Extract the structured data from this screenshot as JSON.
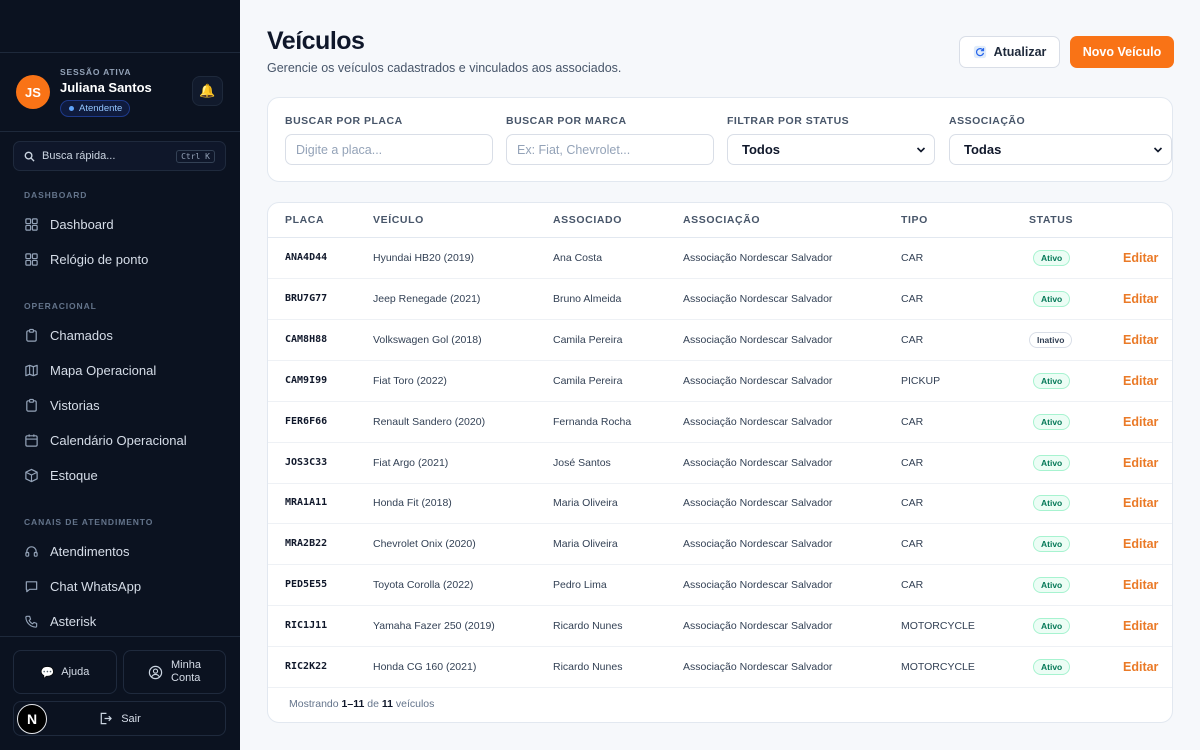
{
  "sidebar": {
    "user": {
      "initials": "JS",
      "session_label": "SESSÃO ATIVA",
      "name": "Juliana Santos",
      "role": "Atendente"
    },
    "search": {
      "label": "Busca rápida...",
      "shortcut": "Ctrl K"
    },
    "sections": [
      {
        "title": "DASHBOARD",
        "items": [
          {
            "label": "Dashboard",
            "icon": "grid-icon"
          },
          {
            "label": "Relógio de ponto",
            "icon": "grid-icon"
          }
        ]
      },
      {
        "title": "OPERACIONAL",
        "items": [
          {
            "label": "Chamados",
            "icon": "clipboard-icon"
          },
          {
            "label": "Mapa Operacional",
            "icon": "map-icon"
          },
          {
            "label": "Vistorias",
            "icon": "clipboard-icon"
          },
          {
            "label": "Calendário Operacional",
            "icon": "calendar-icon"
          },
          {
            "label": "Estoque",
            "icon": "box-icon"
          }
        ]
      },
      {
        "title": "CANAIS DE ATENDIMENTO",
        "items": [
          {
            "label": "Atendimentos",
            "icon": "headset-icon"
          },
          {
            "label": "Chat WhatsApp",
            "icon": "chat-icon"
          },
          {
            "label": "Asterisk",
            "icon": "phone-icon"
          }
        ]
      }
    ],
    "footer": {
      "help": "Ajuda",
      "account_line1": "Minha",
      "account_line2": "Conta",
      "logout": "Sair",
      "logo_letter": "N"
    }
  },
  "header": {
    "title": "Veículos",
    "subtitle": "Gerencie os veículos cadastrados e vinculados aos associados.",
    "refresh_label": "Atualizar",
    "new_label": "Novo Veículo"
  },
  "filters": {
    "plate": {
      "label": "BUSCAR POR PLACA",
      "placeholder": "Digite a placa..."
    },
    "brand": {
      "label": "BUSCAR POR MARCA",
      "placeholder": "Ex: Fiat, Chevrolet..."
    },
    "status": {
      "label": "FILTRAR POR STATUS",
      "value": "Todos"
    },
    "association": {
      "label": "ASSOCIAÇÃO",
      "value": "Todas"
    }
  },
  "table": {
    "columns": [
      "PLACA",
      "VEÍCULO",
      "ASSOCIADO",
      "ASSOCIAÇÃO",
      "TIPO",
      "STATUS"
    ],
    "edit_label": "Editar",
    "rows": [
      {
        "plate": "ANA4D44",
        "vehicle": "Hyundai HB20 (2019)",
        "member": "Ana Costa",
        "association": "Associação Nordescar Salvador",
        "type": "CAR",
        "status": "Ativo"
      },
      {
        "plate": "BRU7G77",
        "vehicle": "Jeep Renegade (2021)",
        "member": "Bruno Almeida",
        "association": "Associação Nordescar Salvador",
        "type": "CAR",
        "status": "Ativo"
      },
      {
        "plate": "CAM8H88",
        "vehicle": "Volkswagen Gol (2018)",
        "member": "Camila Pereira",
        "association": "Associação Nordescar Salvador",
        "type": "CAR",
        "status": "Inativo"
      },
      {
        "plate": "CAM9I99",
        "vehicle": "Fiat Toro (2022)",
        "member": "Camila Pereira",
        "association": "Associação Nordescar Salvador",
        "type": "PICKUP",
        "status": "Ativo"
      },
      {
        "plate": "FER6F66",
        "vehicle": "Renault Sandero (2020)",
        "member": "Fernanda Rocha",
        "association": "Associação Nordescar Salvador",
        "type": "CAR",
        "status": "Ativo"
      },
      {
        "plate": "JOS3C33",
        "vehicle": "Fiat Argo (2021)",
        "member": "José Santos",
        "association": "Associação Nordescar Salvador",
        "type": "CAR",
        "status": "Ativo"
      },
      {
        "plate": "MRA1A11",
        "vehicle": "Honda Fit (2018)",
        "member": "Maria Oliveira",
        "association": "Associação Nordescar Salvador",
        "type": "CAR",
        "status": "Ativo"
      },
      {
        "plate": "MRA2B22",
        "vehicle": "Chevrolet Onix (2020)",
        "member": "Maria Oliveira",
        "association": "Associação Nordescar Salvador",
        "type": "CAR",
        "status": "Ativo"
      },
      {
        "plate": "PED5E55",
        "vehicle": "Toyota Corolla (2022)",
        "member": "Pedro Lima",
        "association": "Associação Nordescar Salvador",
        "type": "CAR",
        "status": "Ativo"
      },
      {
        "plate": "RIC1J11",
        "vehicle": "Yamaha Fazer 250 (2019)",
        "member": "Ricardo Nunes",
        "association": "Associação Nordescar Salvador",
        "type": "MOTORCYCLE",
        "status": "Ativo"
      },
      {
        "plate": "RIC2K22",
        "vehicle": "Honda CG 160 (2021)",
        "member": "Ricardo Nunes",
        "association": "Associação Nordescar Salvador",
        "type": "MOTORCYCLE",
        "status": "Ativo"
      }
    ],
    "footer": {
      "prefix": "Mostrando",
      "range": "1–11",
      "of": "de",
      "total": "11",
      "suffix": "veículos"
    }
  }
}
